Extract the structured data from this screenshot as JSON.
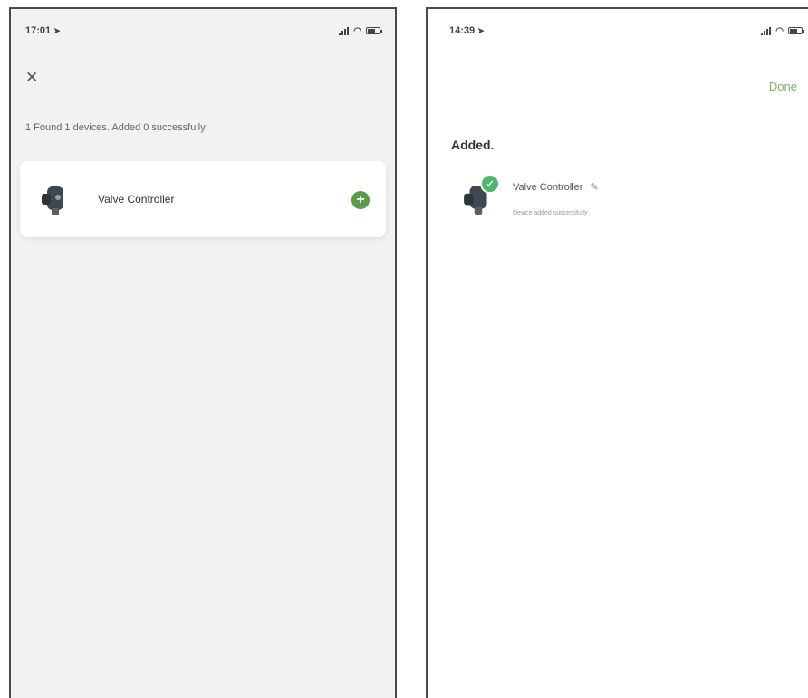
{
  "left_screen": {
    "status_time": "17:01",
    "close_icon": "close-icon",
    "found_text": "1 Found 1 devices. Added 0 successfully",
    "device": {
      "name": "Valve Controller",
      "action_icon": "plus-circle-icon"
    }
  },
  "right_screen": {
    "status_time": "14:39",
    "done_label": "Done",
    "added_title": "Added.",
    "device": {
      "name": "Valve Controller",
      "status": "Device added successfully"
    }
  },
  "colors": {
    "add_button": "#5b9a4a",
    "done_text": "#7cb063",
    "check_badge": "#49b86a"
  }
}
